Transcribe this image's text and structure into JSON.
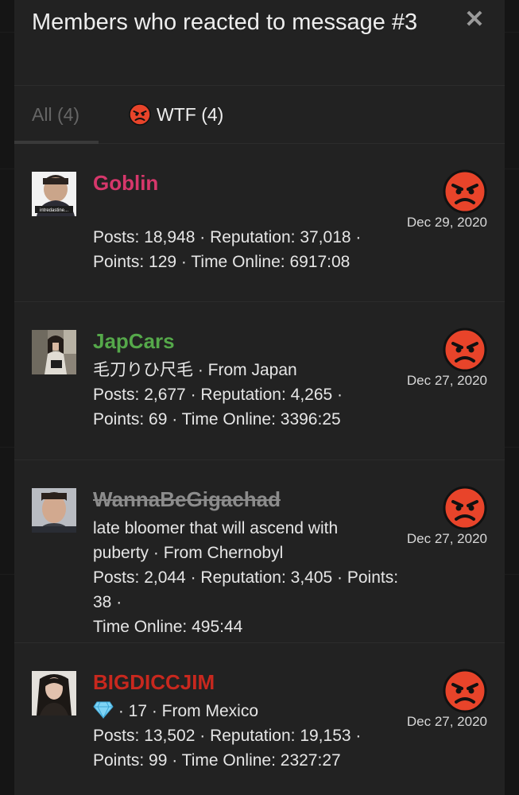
{
  "modal": {
    "title": "Members who reacted to message #3",
    "close_icon": "close-icon"
  },
  "tabs": {
    "all_label": "All (4)",
    "wtf_label": "WTF (4)",
    "wtf_icon": "angry-face-icon"
  },
  "colors": {
    "goblin": "#d6376b",
    "japcars": "#55a84a",
    "wannabe": "#8c8c8c",
    "bigdicc": "#c8281e",
    "angry_face": "#e8442a"
  },
  "members": [
    {
      "name": "Goblin",
      "subtitle": "",
      "stats_line1": "Posts: 18,948 · Reputation: 37,018 ·",
      "stats_line2": "Points: 129 · Time Online: 6917:08",
      "date": "Dec 29, 2020",
      "avatar_caption": "intredastine..."
    },
    {
      "name": "JapCars",
      "subtitle": "毛刀りひ尺毛 · From Japan",
      "stats_line1": "Posts: 2,677 · Reputation: 4,265 ·",
      "stats_line2": "Points: 69 · Time Online: 3396:25",
      "date": "Dec 27, 2020"
    },
    {
      "name": "WannaBeGigachad",
      "subtitle_line1": "late bloomer that will ascend with",
      "subtitle_line2": "puberty · From Chernobyl",
      "stats_line1": "Posts: 2,044 · Reputation: 3,405 · Points: 38 ·",
      "stats_line2": "Time Online: 495:44",
      "date": "Dec 27, 2020"
    },
    {
      "name": "BIGDICCJIM",
      "subtitle": " · 17 · From Mexico",
      "badge_icon": "diamond-icon",
      "stats_line1": "Posts: 13,502 · Reputation: 19,153 ·",
      "stats_line2": "Points: 99 · Time Online: 2327:27",
      "date": "Dec 27, 2020"
    }
  ]
}
